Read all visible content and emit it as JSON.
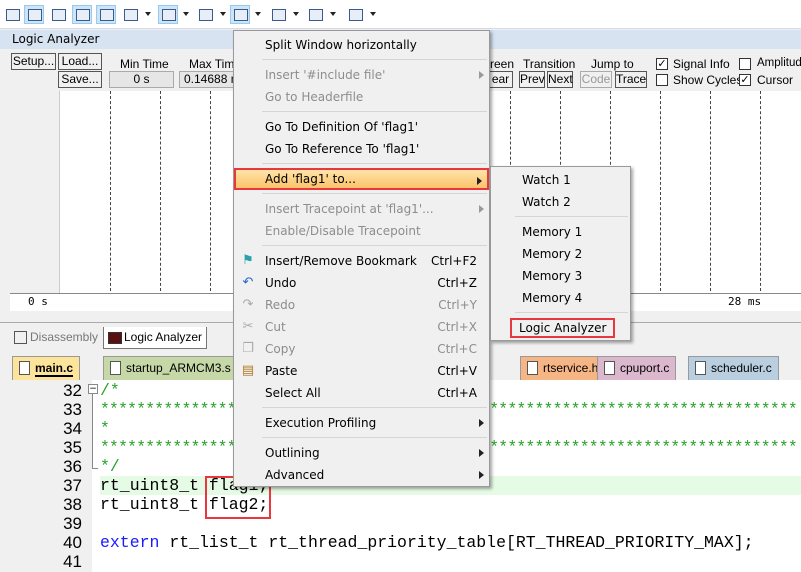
{
  "toolbar": {
    "icons": [
      "command-window-icon",
      "disassembly-window-icon",
      "symbols-window-icon",
      "registers-window-icon",
      "call-stack-icon",
      "watch-windows-icon",
      "memory-windows-icon",
      "serial-windows-icon",
      "analysis-windows-icon",
      "trace-windows-icon",
      "system-viewer-icon",
      "toolbox-icon"
    ]
  },
  "logic_analyzer": {
    "title": "Logic Analyzer",
    "setup": "Setup...",
    "load": "Load...",
    "save": "Save...",
    "min_time_label": "Min Time",
    "min_time_value": "0 s",
    "max_time_label": "Max Time",
    "max_time_value": "0.14688 m",
    "screen_label": "reen",
    "clear_button": "ear",
    "transition_label": "Transition",
    "prev_button": "Prev",
    "next_button": "Next",
    "jump_to_label": "Jump to",
    "code_button": "Code",
    "trace_button": "Trace",
    "signal_info": {
      "label": "Signal Info",
      "checked": true
    },
    "amplitude": {
      "label": "Amplitude",
      "checked": false
    },
    "show_cycles": {
      "label": "Show Cycles",
      "checked": false
    },
    "cursor": {
      "label": "Cursor",
      "checked": true
    },
    "axis_start": "0 s",
    "axis_end": "28 ms"
  },
  "bottom_tabs": [
    {
      "label": "Disassembly",
      "active": false
    },
    {
      "label": "Logic Analyzer",
      "active": true
    }
  ],
  "editor_tabs": [
    {
      "label": "main.c",
      "color": "#fce49a",
      "active": true
    },
    {
      "label": "startup_ARMCM3.s",
      "color": "#c7d8a8"
    },
    {
      "label": "rtservice.h",
      "color": "#f5b585"
    },
    {
      "label": "cpuport.c",
      "color": "#dcb8cf"
    },
    {
      "label": "scheduler.c",
      "color": "#b9cfe0"
    }
  ],
  "code_lines": [
    {
      "num": "32",
      "text": "/*",
      "type": "comment"
    },
    {
      "num": "33",
      "text": "*****************************************************************************",
      "type": "comment"
    },
    {
      "num": "34",
      "text": "*",
      "type": "comment"
    },
    {
      "num": "35",
      "text": "*****************************************************************************",
      "type": "comment"
    },
    {
      "num": "36",
      "text": "*/",
      "type": "comment"
    },
    {
      "num": "37",
      "text": "rt_uint8_t flag1;",
      "type": "current"
    },
    {
      "num": "38",
      "text": "rt_uint8_t flag2;",
      "type": "normal"
    },
    {
      "num": "39",
      "text": "",
      "type": "normal"
    },
    {
      "num": "40",
      "keyword": "extern",
      "text": " rt_list_t rt_thread_priority_table[RT_THREAD_PRIORITY_MAX];",
      "type": "keyword"
    },
    {
      "num": "41",
      "text": "",
      "type": "normal"
    }
  ],
  "context_menu": [
    {
      "label": "Split Window horizontally"
    },
    {
      "sep": true
    },
    {
      "label": "Insert '#include file'",
      "disabled": true,
      "submenu": true
    },
    {
      "label": "Go to Headerfile",
      "disabled": true
    },
    {
      "sep": true
    },
    {
      "label": "Go To Definition Of 'flag1'"
    },
    {
      "label": "Go To Reference To 'flag1'"
    },
    {
      "sep": true
    },
    {
      "label": "Add 'flag1' to...",
      "submenu": true,
      "highlighted": true
    },
    {
      "sep": true
    },
    {
      "label": "Insert Tracepoint at 'flag1'...",
      "disabled": true,
      "submenu": true
    },
    {
      "label": "Enable/Disable Tracepoint",
      "disabled": true
    },
    {
      "sep": true
    },
    {
      "label": "Insert/Remove Bookmark",
      "shortcut": "Ctrl+F2",
      "icon": "bookmark-flag-icon"
    },
    {
      "label": "Undo",
      "shortcut": "Ctrl+Z",
      "icon": "undo-icon"
    },
    {
      "label": "Redo",
      "shortcut": "Ctrl+Y",
      "disabled": true,
      "icon": "redo-icon"
    },
    {
      "label": "Cut",
      "shortcut": "Ctrl+X",
      "disabled": true,
      "icon": "cut-icon"
    },
    {
      "label": "Copy",
      "shortcut": "Ctrl+C",
      "disabled": true,
      "icon": "copy-icon"
    },
    {
      "label": "Paste",
      "shortcut": "Ctrl+V",
      "icon": "paste-icon"
    },
    {
      "label": "Select All",
      "shortcut": "Ctrl+A"
    },
    {
      "sep": true
    },
    {
      "label": "Execution Profiling",
      "submenu": true
    },
    {
      "sep": true
    },
    {
      "label": "Outlining",
      "submenu": true
    },
    {
      "label": "Advanced",
      "submenu": true
    }
  ],
  "submenu": [
    {
      "label": "Watch 1"
    },
    {
      "label": "Watch 2"
    },
    {
      "sep": true
    },
    {
      "label": "Memory 1"
    },
    {
      "label": "Memory 2"
    },
    {
      "label": "Memory 3"
    },
    {
      "label": "Memory 4"
    },
    {
      "sep": true
    },
    {
      "label": "Logic Analyzer",
      "boxed": true
    }
  ],
  "colors": {
    "highlight_box": "#e8383d",
    "menu_highlight": "#fbc36b",
    "comment": "#2aa22a",
    "keyword": "#1a1aff",
    "current_line": "#e6fbe6"
  }
}
